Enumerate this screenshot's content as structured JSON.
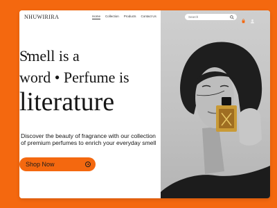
{
  "brand": {
    "logo": "NHUWIRIRA"
  },
  "nav": {
    "items": [
      "Home",
      "Collection",
      "Products",
      "Contact Us"
    ],
    "active_index": 0
  },
  "search": {
    "placeholder": "Search"
  },
  "hero": {
    "headline_line1": "Smell is a",
    "headline_line2": "word • Perfume is",
    "headline_line3": "literature",
    "description": "Discover the beauty of fragrance with our collection of premium perfumes to enrich your everyday smell",
    "cta_label": "Shop Now"
  },
  "icons": {
    "search": "search-icon",
    "cart": "shopping-bag-icon",
    "profile": "user-icon",
    "cta": "arrow-right-circle-icon",
    "sparkle": "sparkle-icon"
  },
  "colors": {
    "accent": "#f4680f",
    "background": "#ffffff",
    "text": "#151515",
    "photo_bg": "#c6c6c6"
  }
}
